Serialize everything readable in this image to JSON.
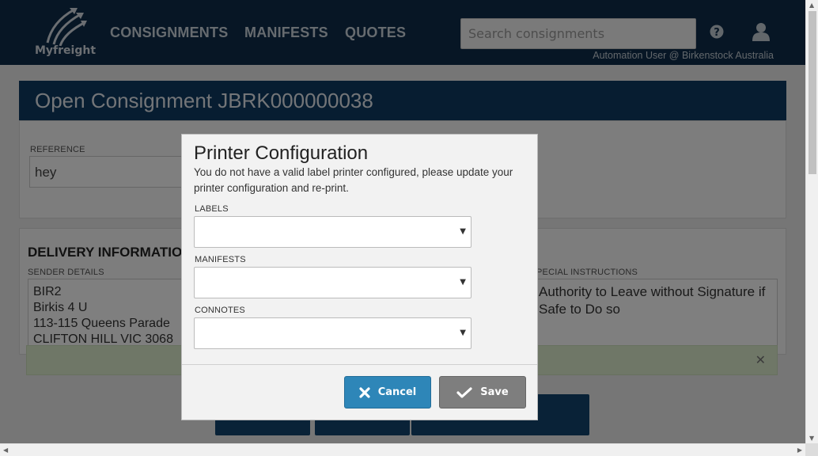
{
  "header": {
    "logo_text": "Myfreight",
    "nav": [
      "CONSIGNMENTS",
      "MANIFESTS",
      "QUOTES"
    ],
    "search_placeholder": "Search consignments",
    "user_line": "Automation User @ Birkenstock Australia"
  },
  "page": {
    "title": "Open Consignment JBRK000000038",
    "reference_label": "REFERENCE",
    "reference_value": "hey",
    "delivery_title": "DELIVERY INFORMATIO",
    "sender_label": "SENDER DETAILS",
    "sender_lines": [
      "BIR2",
      "Birkis 4 U",
      "113-115 Queens Parade",
      "CLIFTON HILL VIC 3068"
    ],
    "special_label": "PECIAL INSTRUCTIONS",
    "special_text": "Authority to Leave without Signature if Safe to Do so"
  },
  "modal": {
    "title": "Printer Configuration",
    "message": "You do not have a valid label printer configured, please update your printer configuration and re-print.",
    "fields": [
      {
        "label": "LABELS",
        "value": ""
      },
      {
        "label": "MANIFESTS",
        "value": ""
      },
      {
        "label": "CONNOTES",
        "value": ""
      }
    ],
    "cancel_label": "Cancel",
    "save_label": "Save"
  },
  "colors": {
    "header_bg": "#0f2d4a",
    "title_bar_bg": "#0f3b63",
    "cancel_bg": "#2e86b8",
    "save_bg": "#7e7e7e",
    "alert_bg": "#dfeecf"
  }
}
